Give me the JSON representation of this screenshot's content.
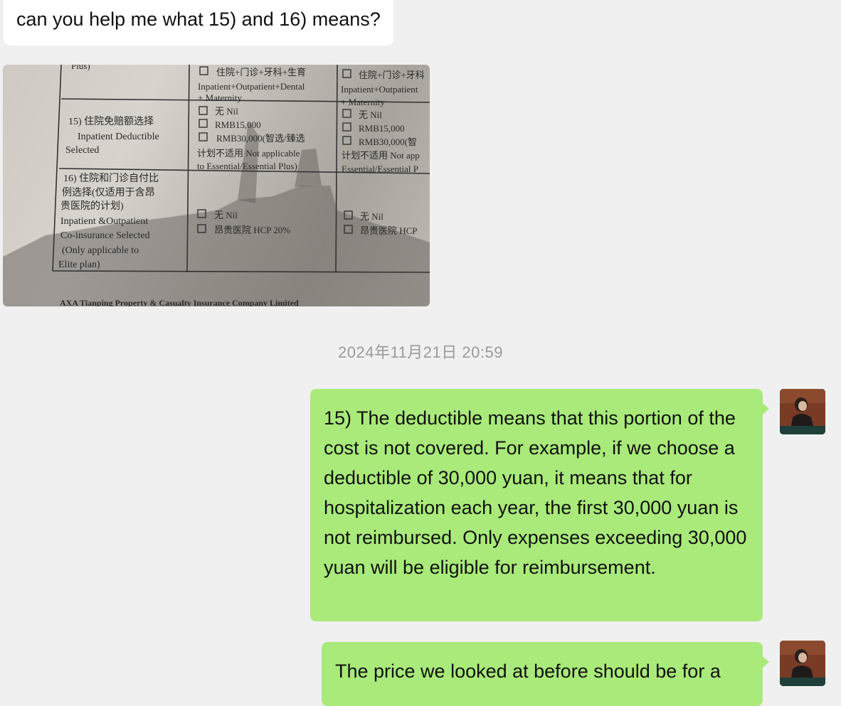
{
  "messages": {
    "incoming_question": "can you help me what 15) and 16) means?",
    "timestamp": "2024年11月21日 20:59",
    "reply_1": "15) The deductible means that this portion of the cost is not covered. For example, if we choose a deductible of 30,000 yuan, it means that for hospitalization each year, the first 30,000 yuan is not reimbursed. Only expenses exceeding 30,000 yuan will be eligible for reimbursement.",
    "reply_2": "The price we looked at before should be for a"
  },
  "photo": {
    "row_top_col1": "Plus)",
    "col1_top_line1": "住院+门诊+牙科+生育",
    "col1_top_line2": "Inpatient+Outpatient+Dental",
    "col1_top_line3": "+ Maternity",
    "col2_top_line1": "住院+门诊+牙科",
    "col2_top_line2": "Inpatient+Outpatient",
    "col2_top_line3": "+ Maternity",
    "q15_line1": "15) 住院免赔额选择",
    "q15_line2": "Inpatient Deductible",
    "q15_line3": "Selected",
    "q15_opt1": "无 Nil",
    "q15_opt2": "RMB15,000",
    "q15_opt3": "RMB30,000(智选/臻选",
    "q15_opt3b": "计划不适用 Not applicable",
    "q15_opt3c": "to Essential/Essential Plus)",
    "q15_col2_opt1": "无 Nil",
    "q15_col2_opt2": "RMB15,000",
    "q15_col2_opt3": "RMB30,000(智",
    "q15_col2_opt3b": "计划不适用 Not app",
    "q15_col2_opt3c": "Essential/Essential P",
    "q16_line1": "16) 住院和门诊自付比",
    "q16_line2": "例选择(仅适用于含昂",
    "q16_line3": "贵医院的计划)",
    "q16_line4": "Inpatient &Outpatient",
    "q16_line5": "Co-insurance Selected",
    "q16_line6": "(Only applicable to",
    "q16_line7": "Elite plan)",
    "q16_opt1": "无 Nil",
    "q16_opt2": "昂贵医院 HCP 20%",
    "q16_col2_opt1": "无 Nil",
    "q16_col2_opt2": "昂贵医院 HCP",
    "footer": "AXA Tianping Property & Casualty Insurance Company Limited"
  },
  "colors": {
    "background": "#f0f0f0",
    "incoming_bubble": "#ffffff",
    "outgoing_bubble": "#a9ea7a",
    "timestamp_text": "#9a9a9a"
  }
}
